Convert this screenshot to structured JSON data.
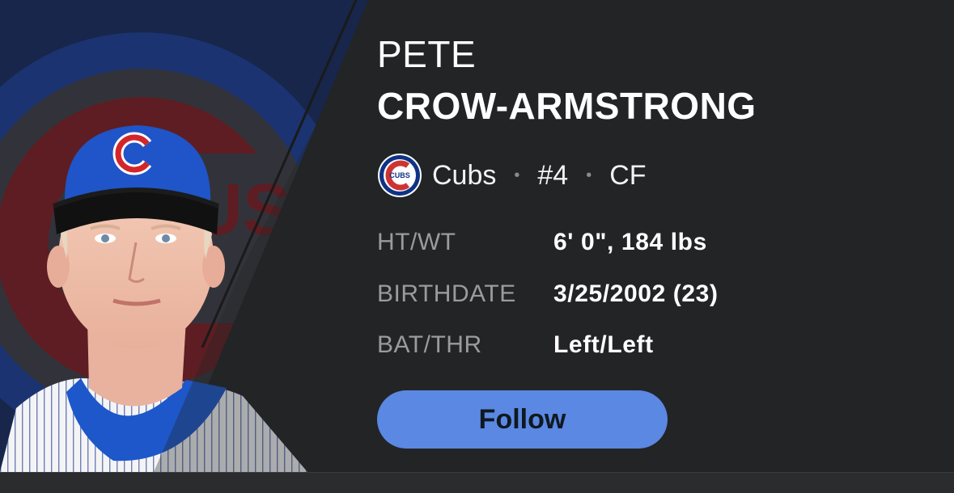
{
  "player": {
    "first_name": "PETE",
    "last_name": "CROW-ARMSTRONG",
    "team": "Cubs",
    "number": "#4",
    "position": "CF",
    "team_logo_text": "CUBS",
    "separator": "•"
  },
  "stats": [
    {
      "label": "HT/WT",
      "value": "6' 0\", 184 lbs"
    },
    {
      "label": "BIRTHDATE",
      "value": "3/25/2002 (23)"
    },
    {
      "label": "BAT/THR",
      "value": "Left/Left"
    }
  ],
  "follow": {
    "label": "Follow"
  },
  "colors": {
    "background": "#232426",
    "accent": "#5a88e2",
    "label": "#9a9b9d",
    "cubs_blue": "#0e3386",
    "cubs_red": "#cc3433"
  },
  "icons": {
    "team_logo": "cubs-logo-icon",
    "headshot": "player-headshot"
  }
}
